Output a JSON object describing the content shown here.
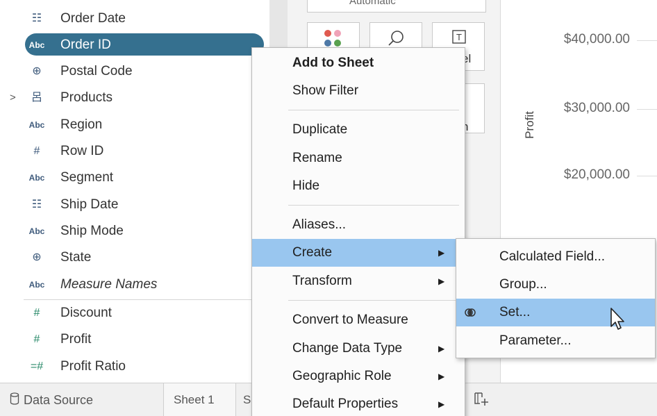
{
  "data_pane": {
    "dimensions": [
      {
        "icon": "calendar-icon",
        "glyph": "☷",
        "name": "Order Date"
      },
      {
        "icon": "abc-icon",
        "glyph": "Abc",
        "name": "Order ID"
      },
      {
        "icon": "globe-icon",
        "glyph": "⊕",
        "name": "Postal Code"
      },
      {
        "icon": "hierarchy-icon",
        "glyph": "呂",
        "name": "Products",
        "expander": ">"
      },
      {
        "icon": "abc-icon",
        "glyph": "Abc",
        "name": "Region"
      },
      {
        "icon": "number-icon",
        "glyph": "#",
        "name": "Row ID"
      },
      {
        "icon": "abc-icon",
        "glyph": "Abc",
        "name": "Segment"
      },
      {
        "icon": "calendar-icon",
        "glyph": "☷",
        "name": "Ship Date"
      },
      {
        "icon": "abc-icon",
        "glyph": "Abc",
        "name": "Ship Mode"
      },
      {
        "icon": "globe-icon",
        "glyph": "⊕",
        "name": "State"
      },
      {
        "icon": "abc-icon",
        "glyph": "Abc",
        "name": "Measure Names"
      }
    ],
    "measures": [
      {
        "icon": "number-icon",
        "glyph": "#",
        "name": "Discount"
      },
      {
        "icon": "number-icon",
        "glyph": "#",
        "name": "Profit"
      },
      {
        "icon": "calc-number-icon",
        "glyph": "=#",
        "name": "Profit Ratio"
      }
    ],
    "selected": "Order ID"
  },
  "marks_card": {
    "mark_type": "Automatic",
    "label_partial": "el",
    "detail_partial": "h",
    "colors": {
      "dot1": "#e05a4f",
      "dot2": "#f0a3b8",
      "dot3": "#4e79a7",
      "dot4": "#59a14f"
    }
  },
  "view": {
    "axis_title": "Profit",
    "ticks": [
      "$40,000.00",
      "$30,000.00",
      "$20,000.00"
    ]
  },
  "tabs": {
    "data_source": "Data Source",
    "sheet1": "Sheet 1",
    "sheet2_partial": "S",
    "new_sheet_icon": "new-worksheet-icon"
  },
  "context_menu": {
    "items": [
      {
        "label": "Add to Sheet",
        "bold": true
      },
      {
        "label": "Show Filter"
      },
      {
        "label": "Duplicate"
      },
      {
        "label": "Rename"
      },
      {
        "label": "Hide"
      },
      {
        "label": "Aliases..."
      },
      {
        "label": "Create",
        "submenu": true,
        "highlighted": true
      },
      {
        "label": "Transform",
        "submenu": true
      },
      {
        "label": "Convert to Measure"
      },
      {
        "label": "Change Data Type",
        "submenu": true
      },
      {
        "label": "Geographic Role",
        "submenu": true
      },
      {
        "label": "Default Properties",
        "submenu": true
      }
    ],
    "submenu_arrow": "▶"
  },
  "create_submenu": {
    "items": [
      {
        "label": "Calculated Field..."
      },
      {
        "label": "Group..."
      },
      {
        "label": "Set...",
        "highlighted": true,
        "icon": "set-icon"
      },
      {
        "label": "Parameter..."
      }
    ]
  },
  "colors": {
    "selected_pill": "#35708f",
    "menu_highlight": "#99c6ef"
  }
}
